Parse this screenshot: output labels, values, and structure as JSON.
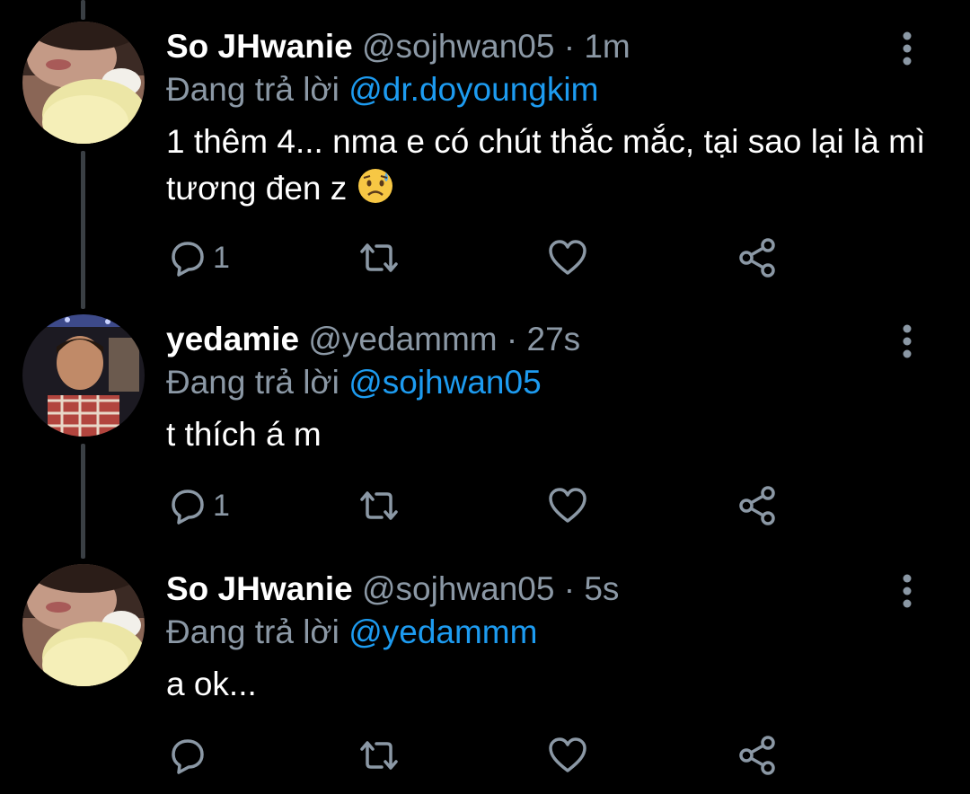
{
  "colors": {
    "background": "#000000",
    "secondary_text": "#8b98a5",
    "link": "#1d9bf0",
    "thread_line": "#3a3f44"
  },
  "tweets": [
    {
      "name": "So JHwanie",
      "handle": "@sojhwan05",
      "separator": "·",
      "time": "1m",
      "replying_prefix": "Đang trả lời",
      "replying_to": "@dr.doyoungkim",
      "text": "1 thêm 4... nma e có chút thắc mắc, tại sao lại là mì tương đen z",
      "emoji": "sad-sweat-face-emoji",
      "reply_count": "1",
      "avatar": "avatar-so-jhwanie"
    },
    {
      "name": "yedamie",
      "handle": "@yedammm",
      "separator": "·",
      "time": "27s",
      "replying_prefix": "Đang trả lời",
      "replying_to": "@sojhwan05",
      "text": "t thích á m",
      "reply_count": "1",
      "avatar": "avatar-yedamie"
    },
    {
      "name": "So JHwanie",
      "handle": "@sojhwan05",
      "separator": "·",
      "time": "5s",
      "replying_prefix": "Đang trả lời",
      "replying_to": "@yedammm",
      "text": "a ok...",
      "reply_count": "",
      "avatar": "avatar-so-jhwanie"
    }
  ],
  "icons": [
    "reply-icon",
    "retweet-icon",
    "like-icon",
    "share-icon",
    "more-options-icon"
  ]
}
